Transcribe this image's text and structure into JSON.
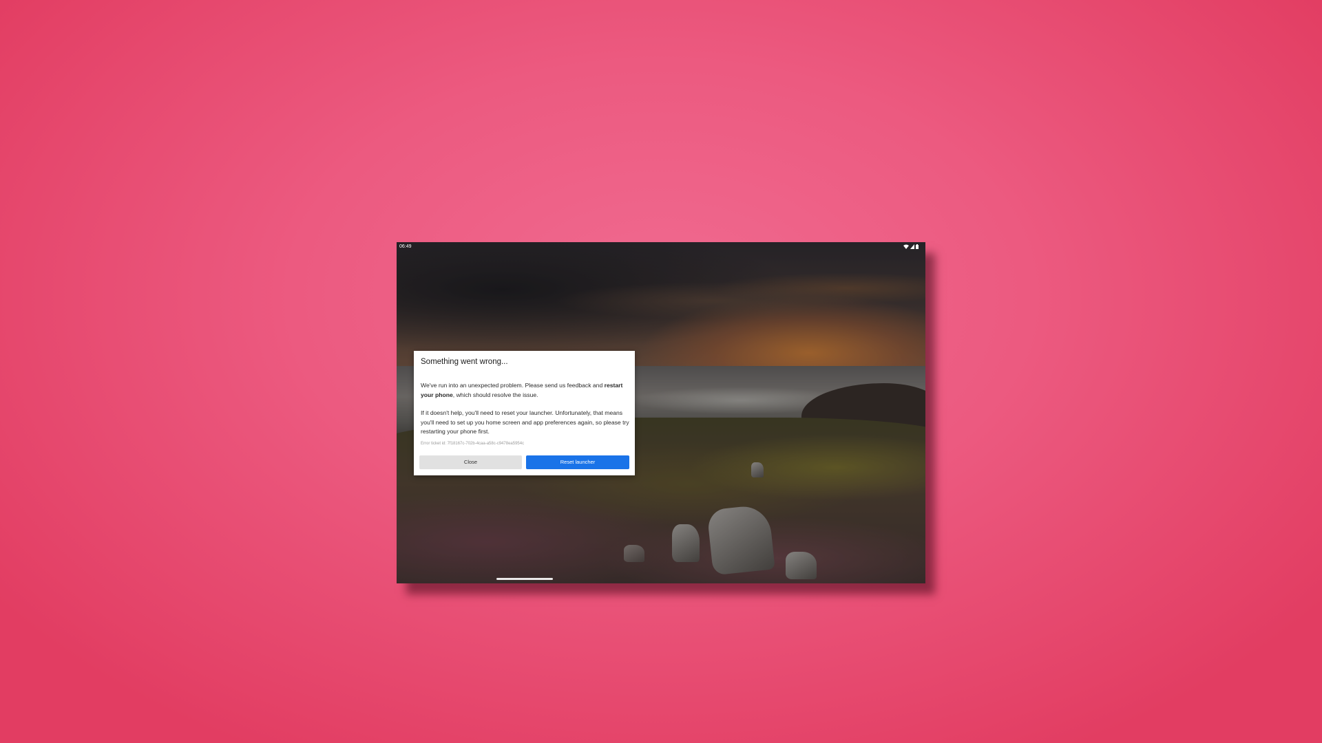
{
  "status_bar": {
    "time": "06:49",
    "icons": [
      "wifi-icon",
      "signal-icon",
      "battery-icon"
    ]
  },
  "wallpaper": {
    "description_icon": "landscape-wallpaper"
  },
  "dialog": {
    "title": "Something went wrong...",
    "paragraph1": {
      "text_before": "We've run into an unexpected problem. Please send us feedback and ",
      "bold": "restart your phone",
      "text_after": ", which should resolve the issue."
    },
    "paragraph2": "If it doesn't help, you'll need to reset your launcher. Unfortunately, that means you'll need to set up you home screen and app preferences again, so please try restarting your phone first.",
    "ticket": "Error ticket id: 7f18167c-702b-4caa-a58c-c9478ea5954c",
    "close_label": "Close",
    "reset_label": "Reset launcher"
  },
  "colors": {
    "background_pink": "#e23d62",
    "primary_button": "#1a73e8",
    "secondary_button": "#e1e1e1"
  }
}
